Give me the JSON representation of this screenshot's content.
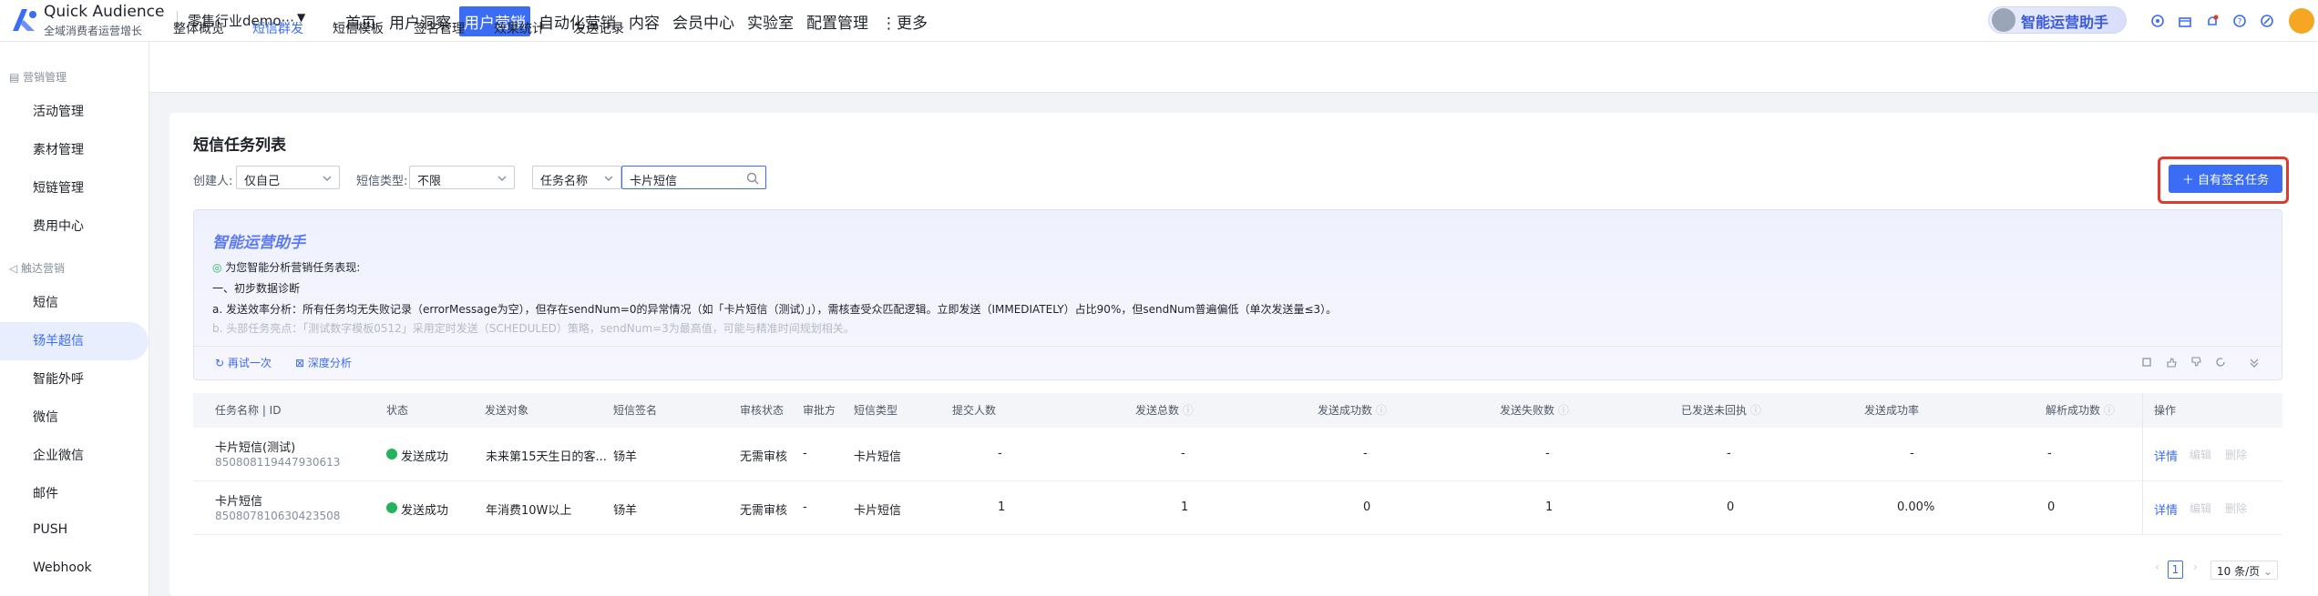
{
  "app": {
    "name": "Quick Audience",
    "subtitle": "全域消费者运营增长",
    "tenant": "零售行业demo···"
  },
  "nav": {
    "items": [
      "首页",
      "用户洞察",
      "用户营销",
      "自动化营销",
      "内容",
      "会员中心",
      "实验室",
      "配置管理",
      "⋮更多"
    ],
    "active_index": 2
  },
  "assistant": {
    "label": "智能运营助手"
  },
  "header_icons": [
    "support-icon",
    "gift-icon",
    "bell-icon",
    "help-icon",
    "settings-icon"
  ],
  "sidebar": {
    "group1": "营销管理",
    "group1_items": [
      "活动管理",
      "素材管理",
      "短链管理",
      "费用中心"
    ],
    "group2": "触达营销",
    "group2_items": [
      "短信",
      "钖羊超信",
      "智能外呼",
      "微信",
      "企业微信",
      "邮件",
      "PUSH",
      "Webhook"
    ],
    "active_item": "钖羊超信"
  },
  "subtabs": {
    "items": [
      "整体概览",
      "短信群发",
      "短信模板",
      "签名管理",
      "效果统计",
      "发送记录"
    ],
    "active_index": 1
  },
  "page": {
    "title": "短信任务列表"
  },
  "filters": {
    "creator_label": "创建人:",
    "creator_value": "仅自己",
    "type_label": "短信类型:",
    "type_value": "不限",
    "field_value": "任务名称",
    "search_value": "卡片短信"
  },
  "primary_button": {
    "label": "＋ 自有签名任务"
  },
  "ai_panel": {
    "title": "智能运营助手",
    "intro": "为您智能分析营销任务表现:",
    "section": "一、初步数据诊断",
    "line_a": "a. 发送效率分析：所有任务均无失败记录（errorMessage为空），但存在sendNum=0的异常情况（如「卡片短信（测试）」），需核查受众匹配逻辑。立即发送（IMMEDIATELY）占比90%，但sendNum普遍偏低（单次发送量≤3）。",
    "line_b": "b. 头部任务亮点：「测试数字模板0512」采用定时发送（SCHEDULED）策略，sendNum=3为最高值，可能与精准时间规划相关。",
    "retry_label": "再试一次",
    "deep_label": "深度分析"
  },
  "table": {
    "columns": [
      "任务名称 | ID",
      "状态",
      "发送对象",
      "短信签名",
      "审核状态",
      "审批方",
      "短信类型",
      "提交人数",
      "发送总数",
      "发送成功数",
      "发送失败数",
      "已发送未回执",
      "发送成功率",
      "解析成功数",
      "操作"
    ],
    "rows": [
      {
        "name": "卡片短信(测试)",
        "id": "850808119447930613",
        "status": "发送成功",
        "target": "未来第15天生日的客...",
        "signature": "钖羊",
        "review": "无需审核",
        "approver": "-",
        "type": "卡片短信",
        "submitted": "-",
        "total": "-",
        "success": "-",
        "failed": "-",
        "no_receipt": "-",
        "rate": "-",
        "parsed": "-",
        "op_detail": "详情",
        "op_edit": "编辑",
        "op_delete": "删除"
      },
      {
        "name": "卡片短信",
        "id": "850807810630423508",
        "status": "发送成功",
        "target": "年消费10W以上",
        "signature": "钖羊",
        "review": "无需审核",
        "approver": "-",
        "type": "卡片短信",
        "submitted": "1",
        "total": "1",
        "success": "0",
        "failed": "1",
        "no_receipt": "0",
        "rate": "0.00%",
        "parsed": "0",
        "op_detail": "详情",
        "op_edit": "编辑",
        "op_delete": "删除"
      }
    ]
  },
  "pagination": {
    "prev": "‹",
    "page": "1",
    "next": "›",
    "page_size": "10 条/页"
  },
  "colors": {
    "accent": "#3a6cf4",
    "success": "#23b35a",
    "highlight": "#e03a2f"
  }
}
